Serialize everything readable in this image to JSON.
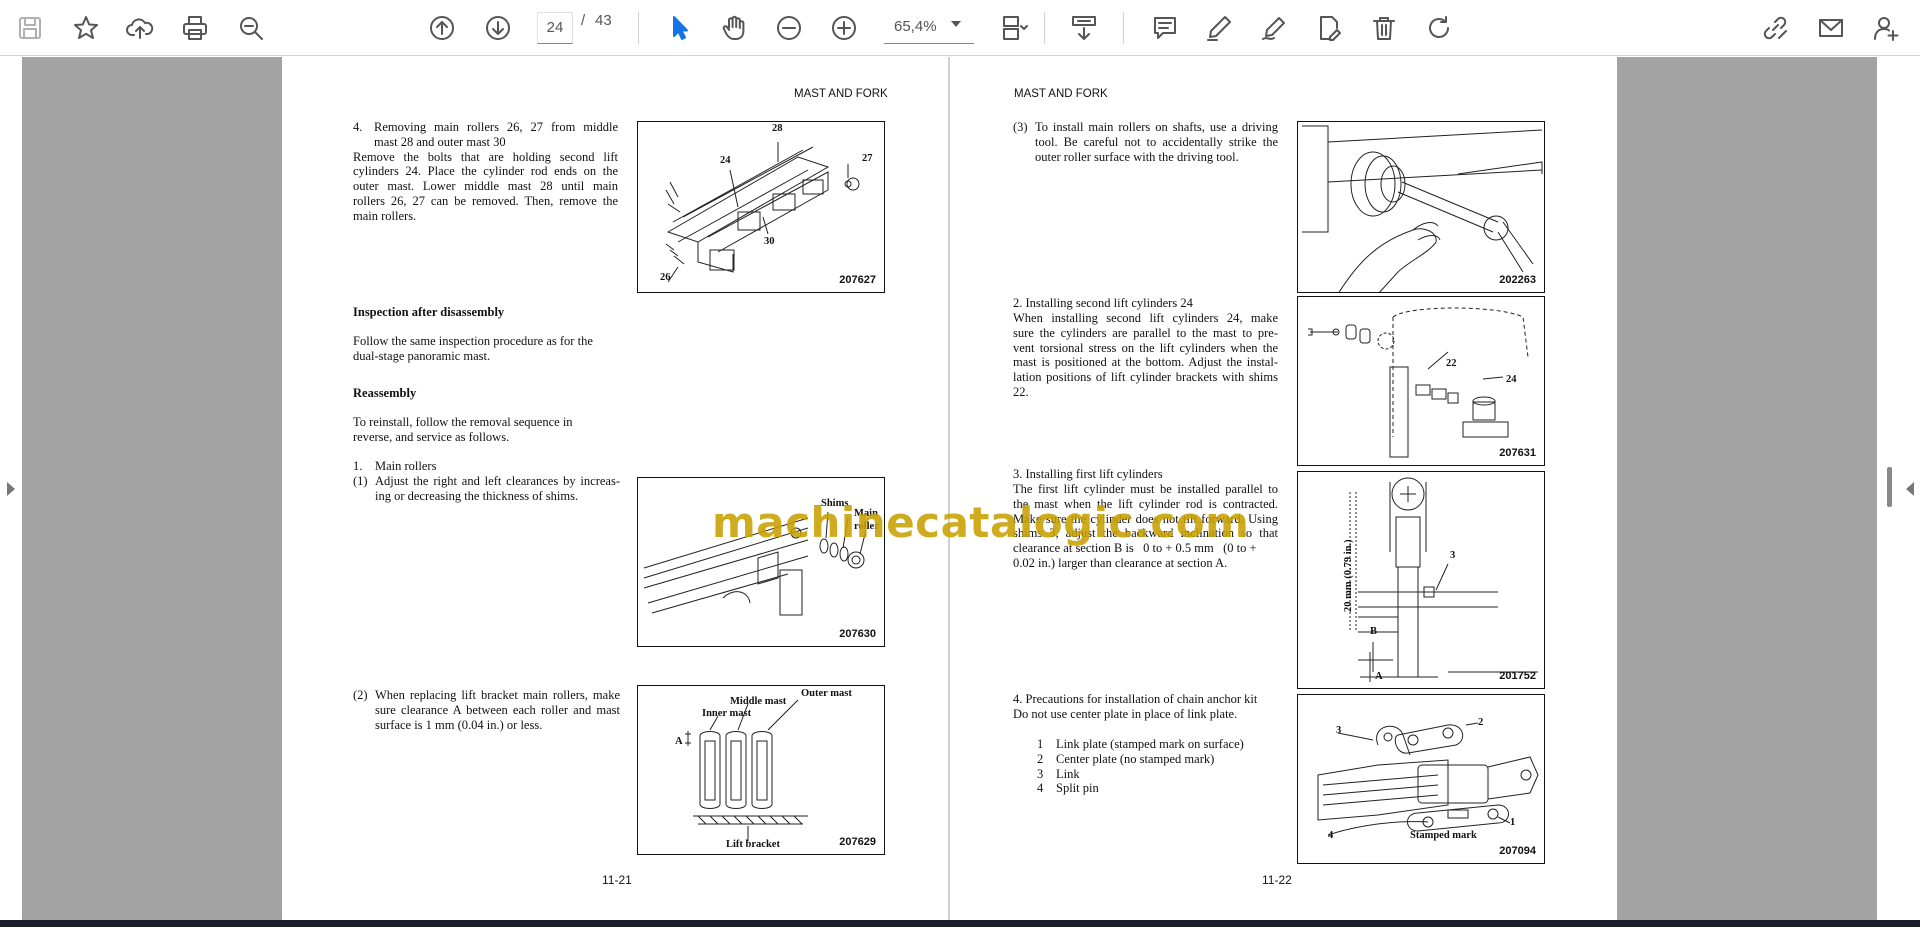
{
  "toolbar": {
    "icons": [
      "save-icon",
      "bookmark-star-icon",
      "upload-cloud-icon",
      "print-icon",
      "zoom-search-icon",
      "page-up-icon",
      "page-down-icon",
      "select-cursor-icon",
      "hand-pan-icon",
      "zoom-out-icon",
      "zoom-in-icon",
      "page-fit-icon",
      "scroll-mode-icon",
      "comment-icon",
      "highlight-pen-icon",
      "draw-icon",
      "sign-icon",
      "delete-icon",
      "rotate-icon",
      "share-link-icon",
      "email-icon",
      "add-user-icon"
    ],
    "current_page": "24",
    "page_separator": "/",
    "total_pages": "43",
    "zoom": "65,4%",
    "colors": {
      "active": "#1473e6",
      "icon": "#555555"
    }
  },
  "watermark": "machinecatalogic.com",
  "left_page": {
    "header": "MAST AND FORK",
    "step4_num": "4.",
    "step4_title_l1": "Removing main rollers 26, 27 from middle",
    "step4_title_l2": "mast 28 and outer mast 30",
    "step4_body": [
      "Remove the bolts that are holding second lift",
      "cylinders 24. Place the cylinder rod ends on the",
      "outer mast. Lower middle mast 28 until main",
      "rollers 26, 27 can be removed. Then, remove the",
      "main rollers."
    ],
    "fig1": {
      "number": "207627",
      "labels": [
        "28",
        "24",
        "27",
        "30",
        "26"
      ]
    },
    "inspection_heading": "Inspection after disassembly",
    "inspection_body": [
      "Follow the same inspection procedure as for the",
      "dual-stage panoramic mast."
    ],
    "reassembly_heading": "Reassembly",
    "reassembly_body": [
      "To reinstall, follow the removal sequence in",
      "reverse, and service as follows."
    ],
    "main_rollers_num": "1.",
    "main_rollers_title": "Main rollers",
    "item1_num": "(1)",
    "item1_body": [
      "Adjust the right and left clearances by increas-",
      "ing or decreasing the thickness of shims."
    ],
    "fig2": {
      "number": "207630",
      "labels": [
        "Shims",
        "Main",
        "roller"
      ]
    },
    "item2_num": "(2)",
    "item2_body": [
      "When replacing lift bracket main rollers, make",
      "sure clearance A between each roller and mast",
      "surface is 1 mm (0.04 in.) or less."
    ],
    "fig3": {
      "number": "207629",
      "labels": [
        "Outer mast",
        "Middle mast",
        "Inner mast",
        "A",
        "Lift bracket"
      ]
    },
    "page_number": "11-21"
  },
  "right_page": {
    "header": "MAST AND FORK",
    "item3_num": "(3)",
    "item3_body": [
      "To install main rollers on shafts, use a driving",
      "tool. Be careful not to accidentally strike the",
      "outer roller surface with the driving tool."
    ],
    "fig4": {
      "number": "202263"
    },
    "step2_title": "2.    Installing second lift cylinders 24",
    "step2_body": [
      "When installing second lift cylinders 24, make",
      "sure the cylinders are parallel to the mast to pre-",
      "vent torsional stress on the lift cylinders when the",
      "mast is positioned at the bottom. Adjust the instal-",
      "lation positions of lift cylinder brackets with shims",
      "22."
    ],
    "fig5": {
      "number": "207631",
      "labels": [
        "22",
        "24"
      ]
    },
    "step3_title": "3.    Installing first lift cylinders",
    "step3_body": [
      "The first lift cylinder must be installed parallel to",
      "the mast when the lift cylinder rod is contracted.",
      "Make sure the cylinder does not tilt forward. Using",
      "shims 3, adjust the backward inclination so that",
      "clearance at section B is   0 to + 0.5 mm   (0 to +",
      "0.02 in.) larger than clearance at section A."
    ],
    "fig6": {
      "number": "201752",
      "labels": [
        "3",
        "20 mm (0.79 in.)",
        "B",
        "A"
      ]
    },
    "step4_title": "4.    Precautions for installation of chain anchor kit",
    "step4_body": "Do not use center plate in place of link plate.",
    "parts": [
      {
        "num": "1",
        "label": "Link plate (stamped mark on surface)"
      },
      {
        "num": "2",
        "label": "Center plate (no stamped mark)"
      },
      {
        "num": "3",
        "label": "Link"
      },
      {
        "num": "4",
        "label": "Split pin"
      }
    ],
    "fig7": {
      "number": "207094",
      "labels": [
        "3",
        "2",
        "1",
        "4",
        "Stamped mark"
      ]
    },
    "page_number": "11-22"
  }
}
